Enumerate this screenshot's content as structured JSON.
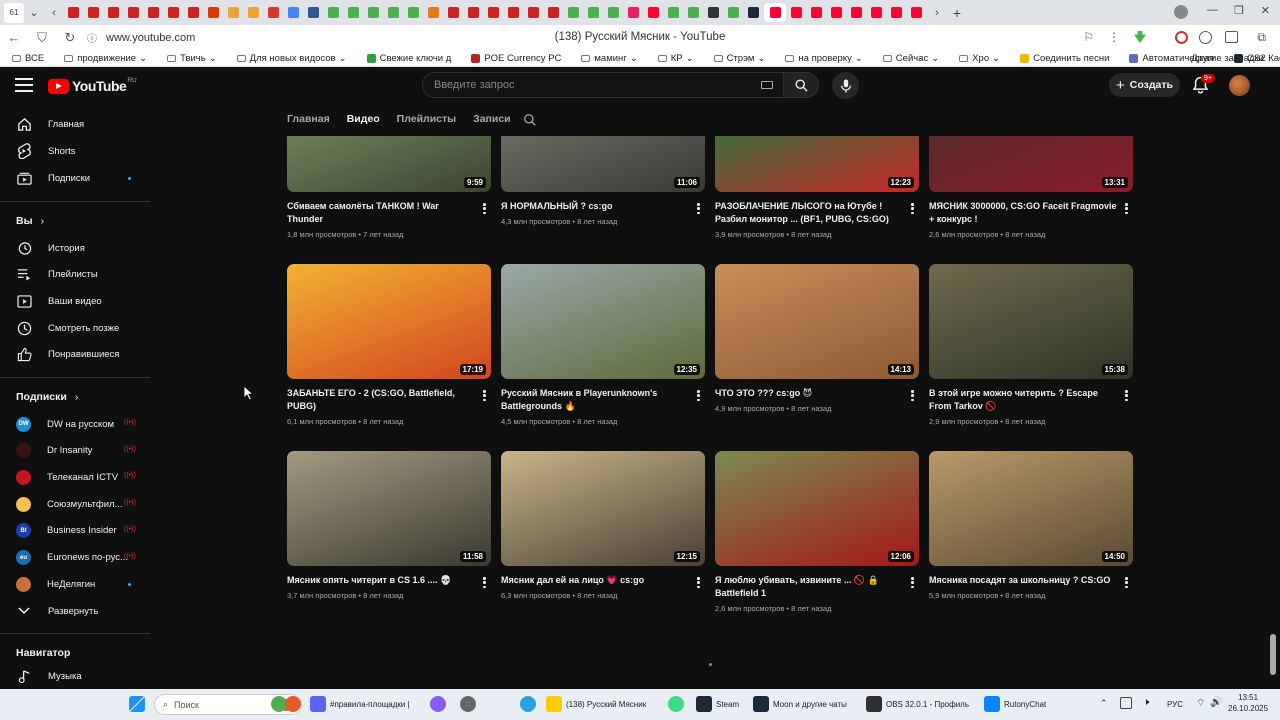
{
  "browser": {
    "tab_count_badge": "61",
    "url": "www.youtube.com",
    "page_title": "(138) Русский Мясник - YouTube",
    "tab_favicon_colors": [
      "#cc2222",
      "#cc2222",
      "#cc2222",
      "#cc2222",
      "#cc2222",
      "#cc2222",
      "#cc2222",
      "#d83b01",
      "#e8a33d",
      "#e8a33d",
      "#d9352b",
      "#4285f4",
      "#2f5597",
      "#4caf50",
      "#4caf50",
      "#4caf50",
      "#4caf50",
      "#4caf50",
      "#e07b1a",
      "#cc2222",
      "#cc2222",
      "#cc2222",
      "#cc2222",
      "#cc2222",
      "#cc2222",
      "#4caf50",
      "#4caf50",
      "#4caf50",
      "#e91e63",
      "#ff0033",
      "#4caf50",
      "#4caf50",
      "#333333",
      "#4caf50",
      "#1b2838",
      "#ff0033",
      "#ff0033",
      "#ff0033",
      "#ff0033",
      "#ff0033",
      "#ff0033",
      "#ff0033",
      "#ff0033"
    ],
    "bookmarks": [
      {
        "label": "ВСЕ",
        "color": ""
      },
      {
        "label": "продвижение",
        "color": ""
      },
      {
        "label": "Твичь",
        "color": ""
      },
      {
        "label": "Для новых видосов",
        "color": ""
      },
      {
        "label": "Свежие ключи д",
        "color": "#2ea043"
      },
      {
        "label": "POE Currency PC",
        "color": "#b3261e"
      },
      {
        "label": "маминг",
        "color": ""
      },
      {
        "label": "КР",
        "color": ""
      },
      {
        "label": "Стрэм",
        "color": ""
      },
      {
        "label": "на проверку",
        "color": ""
      },
      {
        "label": "Сейчас",
        "color": ""
      },
      {
        "label": "Хро",
        "color": ""
      },
      {
        "label": "Соединить песни",
        "color": "#f4b400"
      },
      {
        "label": "Автоматическая",
        "color": "#5c6bc0"
      },
      {
        "label": "CS2 Кастомные",
        "color": "#1b2838"
      }
    ],
    "bookmarks_other": "Другие закладки"
  },
  "header": {
    "logo_text": "YouTube",
    "region": "RU",
    "search_placeholder": "Введите запрос",
    "create_label": "Создать",
    "notifications_badge": "9+"
  },
  "sidebar": {
    "main": [
      {
        "label": "Главная",
        "icon": "home-icon"
      },
      {
        "label": "Shorts",
        "icon": "shorts-icon"
      },
      {
        "label": "Подписки",
        "icon": "subscriptions-icon"
      }
    ],
    "you_title": "Вы",
    "you_items": [
      {
        "label": "История",
        "icon": "history-icon"
      },
      {
        "label": "Плейлисты",
        "icon": "playlists-icon"
      },
      {
        "label": "Ваши видео",
        "icon": "your-videos-icon"
      },
      {
        "label": "Смотреть позже",
        "icon": "watch-later-icon"
      },
      {
        "label": "Понравившиеся",
        "icon": "liked-icon"
      }
    ],
    "subs_title": "Подписки",
    "channels": [
      {
        "label": "DW на русском",
        "avatar_color": "#1a8fd8",
        "avatar_text": "DW",
        "status": "live"
      },
      {
        "label": "Dr Insanity",
        "avatar_color": "#3a1010",
        "avatar_text": "",
        "status": "live"
      },
      {
        "label": "Телеканал ICTV",
        "avatar_color": "#c4161c",
        "avatar_text": "",
        "status": "live"
      },
      {
        "label": "Союзмультфил...",
        "avatar_color": "#f2c14e",
        "avatar_text": "",
        "status": "live"
      },
      {
        "label": "Business Insider",
        "avatar_color": "#1c3faa",
        "avatar_text": "BI",
        "status": "live"
      },
      {
        "label": "Euronews по-рус...",
        "avatar_color": "#1a6fb5",
        "avatar_text": "eu",
        "status": "live"
      },
      {
        "label": "НеДелягин",
        "avatar_color": "#c96f3a",
        "avatar_text": "",
        "status": "new"
      }
    ],
    "expand_label": "Развернуть",
    "navigator_title": "Навигатор",
    "navigator_items": [
      {
        "label": "Музыка",
        "icon": "music-icon"
      }
    ]
  },
  "channel_tabs": {
    "items": [
      "Главная",
      "Видео",
      "Плейлисты",
      "Записи"
    ],
    "selected": "Видео"
  },
  "videos": [
    {
      "title": "Сбиваем самолёты ТАНКОМ ! War Thunder",
      "meta": "1,8 млн просмотров • 7 лет назад",
      "duration": "9:59",
      "thumb": [
        "#6d7f58",
        "#3b4431"
      ]
    },
    {
      "title": "Я НОРМАЛЬНЫЙ ? cs:go",
      "meta": "4,3 млн просмотров • 8 лет назад",
      "duration": "11:06",
      "thumb": [
        "#6a6a62",
        "#3a3a35"
      ]
    },
    {
      "title": "РАЗОБЛАЧЕНИЕ ЛЫСОГО на Ютубе ! Разбил монитор ... (BF1, PUBG, CS:GO)",
      "meta": "3,9 млн просмотров • 8 лет назад",
      "duration": "12:23",
      "thumb": [
        "#3f6a3a",
        "#c62828"
      ]
    },
    {
      "title": "МЯСНИК 3000000, CS:GO Faceit Fragmovie + конкурс !",
      "meta": "2,6 млн просмотров • 8 лет назад",
      "duration": "13:31",
      "thumb": [
        "#5b2a2a",
        "#8a1a2a"
      ]
    },
    {
      "title": "ЗАБАНЬТЕ ЕГО - 2 (CS:GO, Battlefield, PUBG)",
      "meta": "6,1 млн просмотров • 8 лет назад",
      "duration": "17:19",
      "thumb": [
        "#f2b233",
        "#d2451e"
      ]
    },
    {
      "title": "Русский Мясник в Playerunknown's Battlegrounds 🔥",
      "meta": "4,5 млн просмотров • 8 лет назад",
      "duration": "12:35",
      "thumb": [
        "#9aa8a8",
        "#5c6b3c"
      ]
    },
    {
      "title": "ЧТО ЭТО ??? cs:go 😈",
      "meta": "4,9 млн просмотров • 8 лет назад",
      "duration": "14:13",
      "thumb": [
        "#c98e5a",
        "#8c5a33"
      ]
    },
    {
      "title": "В этой игре можно читерить ? Escape From Tarkov 🚫",
      "meta": "2,9 млн просмотров • 8 лет назад",
      "duration": "15:38",
      "thumb": [
        "#6e6a4e",
        "#2f3424"
      ]
    },
    {
      "title": "Мясник опять читерит в CS 1.6 .... 💀",
      "meta": "3,7 млн просмотров • 8 лет назад",
      "duration": "11:58",
      "thumb": [
        "#a49a80",
        "#3a3a30"
      ]
    },
    {
      "title": "Мясник дал ей на лицо 💗 cs:go",
      "meta": "6,3 млн просмотров • 8 лет назад",
      "duration": "12:15",
      "thumb": [
        "#c9b48a",
        "#4a4034"
      ]
    },
    {
      "title": "Я люблю убивать, извините ... 🚫 🔒 Battlefield 1",
      "meta": "2,6 млн просмотров • 8 лет назад",
      "duration": "12:06",
      "thumb": [
        "#7c8a52",
        "#a31818"
      ]
    },
    {
      "title": "Мясника посадят за школьницу ? CS:GO",
      "meta": "5,9 млн просмотров • 8 лет назад",
      "duration": "14:50",
      "thumb": [
        "#b89a6a",
        "#5a4a34"
      ]
    }
  ],
  "taskbar": {
    "search_placeholder": "Поиск",
    "apps": [
      {
        "label": "#правила-площадки |",
        "color": "#5865f2"
      },
      {
        "label": "(138) Русский Мясник",
        "color": "#ffcc00"
      },
      {
        "label": "Steam",
        "color": "#1b2838"
      },
      {
        "label": "Moon и другие чаты",
        "color": "#1b2838"
      },
      {
        "label": "OBS 32.0.1 - Профиль",
        "color": "#302e31"
      },
      {
        "label": "RutonyChat",
        "color": "#0a84ff"
      }
    ],
    "language": "РУС",
    "time": "13:51",
    "date": "26.10.2025"
  }
}
